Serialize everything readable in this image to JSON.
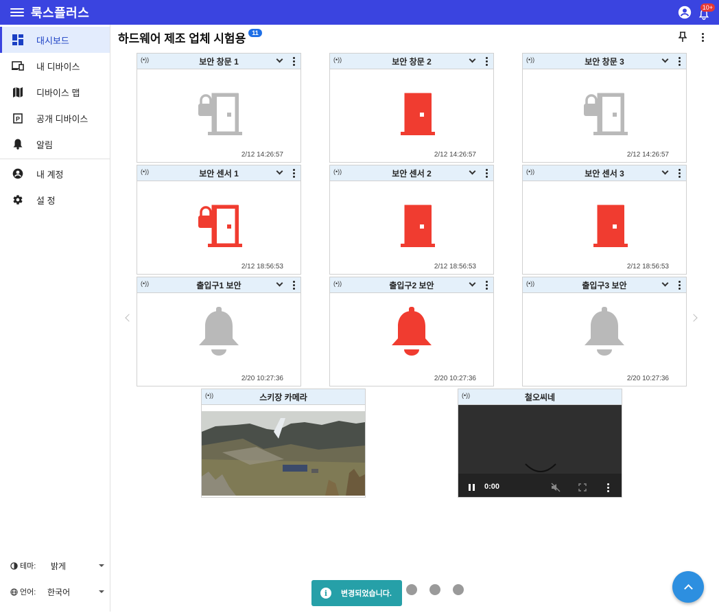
{
  "app": {
    "title": "룩스플러스",
    "notification_badge": "10+"
  },
  "sidebar": {
    "items": [
      {
        "label": "대시보드",
        "icon": "dashboard-icon",
        "active": true
      },
      {
        "label": "내 디바이스",
        "icon": "devices-icon"
      },
      {
        "label": "디바이스 맵",
        "icon": "map-icon"
      },
      {
        "label": "공개 디바이스",
        "icon": "public-device-icon"
      },
      {
        "label": "알림",
        "icon": "bell-icon"
      },
      {
        "label": "내 계정",
        "icon": "account-icon"
      },
      {
        "label": "설 정",
        "icon": "gear-icon"
      }
    ],
    "theme": {
      "label": "테마:",
      "value": "밝게"
    },
    "language": {
      "label": "언어:",
      "value": "한국어"
    }
  },
  "main": {
    "title": "하드웨어 제조 업체 시험용",
    "count": "11"
  },
  "cards": [
    {
      "title": "보안 창문 1",
      "timestamp": "2/12 14:26:57",
      "kind": "door-lock",
      "color": "#b9b9b9"
    },
    {
      "title": "보안 창문 2",
      "timestamp": "2/12 14:26:57",
      "kind": "door",
      "color": "#f03c30"
    },
    {
      "title": "보안 창문 3",
      "timestamp": "2/12 14:26:57",
      "kind": "door-lock",
      "color": "#b9b9b9"
    },
    {
      "title": "보안 센서 1",
      "timestamp": "2/12 18:56:53",
      "kind": "door-lock",
      "color": "#f03c30"
    },
    {
      "title": "보안 센서 2",
      "timestamp": "2/12 18:56:53",
      "kind": "door",
      "color": "#f03c30"
    },
    {
      "title": "보안 센서 3",
      "timestamp": "2/12 18:56:53",
      "kind": "door",
      "color": "#f03c30"
    },
    {
      "title": "출입구1 보안",
      "timestamp": "2/20 10:27:36",
      "kind": "bell",
      "color": "#b9b9b9"
    },
    {
      "title": "출입구2 보안",
      "timestamp": "2/20 10:27:36",
      "kind": "bell",
      "color": "#f03c30"
    },
    {
      "title": "출입구3 보안",
      "timestamp": "2/20 10:27:36",
      "kind": "bell",
      "color": "#b9b9b9"
    }
  ],
  "media": [
    {
      "title": "스키장 카메라"
    },
    {
      "title": "철오씨네",
      "time": "0:00"
    }
  ],
  "toast": {
    "message": "변경되었습니다."
  }
}
